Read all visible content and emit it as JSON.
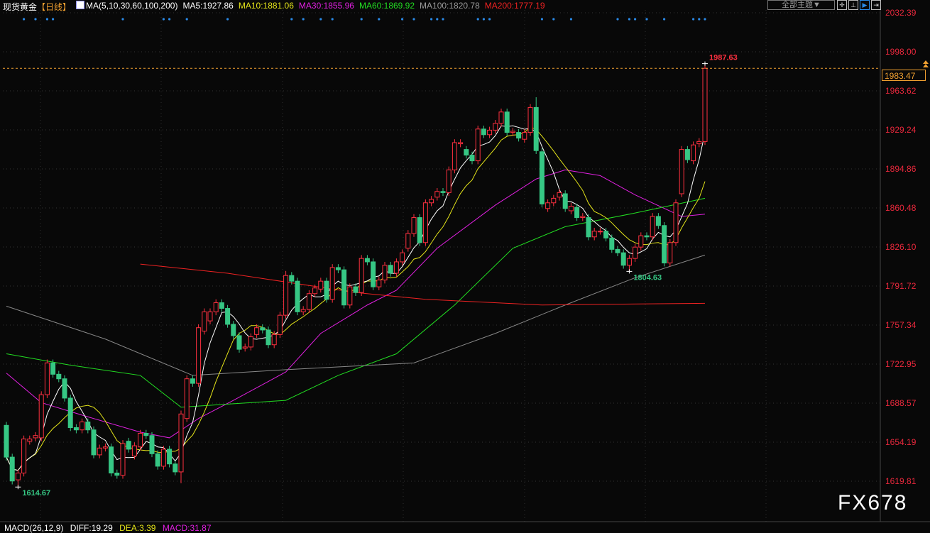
{
  "header": {
    "symbol": "现货黄金",
    "period": "【日线】",
    "ma_params": "MA(5,10,30,60,100,200)",
    "ma5": "MA5:1927.86",
    "ma10": "MA10:1881.06",
    "ma30": "MA30:1855.96",
    "ma60": "MA60:1869.92",
    "ma100": "MA100:1820.78",
    "ma200": "MA200:1777.19"
  },
  "toolbar": {
    "theme_label": "全部主题▼",
    "icons": [
      "crosshair-icon",
      "range-icon",
      "play-icon",
      "shift-right-icon"
    ]
  },
  "watermark": "FX678",
  "macd": {
    "params": "MACD(26,12,9)",
    "diff": "DIFF:19.29",
    "dea": "DEA:3.39",
    "macd": "MACD:31.87"
  },
  "colors": {
    "up": "#ff3040",
    "down": "#36c784",
    "ma5": "#ffffff",
    "ma10": "#e5e51a",
    "ma30": "#e020e0",
    "ma60": "#22dd22",
    "ma100": "#888888",
    "ma200": "#ee2222",
    "accent": "#f0a030"
  },
  "chart_data": {
    "type": "candlestick",
    "title": "现货黄金 日线",
    "ylim": [
      1619.81,
      2032.39
    ],
    "y_ticks": [
      "2032.39",
      "1998.00",
      "1963.62",
      "1929.24",
      "1894.86",
      "1860.48",
      "1826.10",
      "1791.72",
      "1757.34",
      "1722.95",
      "1688.57",
      "1654.19",
      "1619.81"
    ],
    "current_price": "1983.47",
    "high_label": "1987.63",
    "low_labels": [
      "1614.67",
      "1804.63"
    ],
    "open": [
      1669,
      1641,
      1621,
      1627,
      1655,
      1658,
      1658,
      1696,
      1724,
      1714,
      1710,
      1693,
      1667,
      1665,
      1672,
      1665,
      1643,
      1649,
      1650,
      1627,
      1625,
      1655,
      1642,
      1650,
      1662,
      1660,
      1644,
      1633,
      1648,
      1635,
      1628,
      1675,
      1710,
      1706,
      1752,
      1761,
      1769,
      1777,
      1772,
      1758,
      1748,
      1737,
      1738,
      1749,
      1755,
      1753,
      1740,
      1749,
      1766,
      1801,
      1796,
      1769,
      1771,
      1785,
      1789,
      1796,
      1780,
      1808,
      1806,
      1775,
      1791,
      1786,
      1816,
      1813,
      1791,
      1797,
      1810,
      1803,
      1813,
      1825,
      1838,
      1852,
      1830,
      1865,
      1870,
      1875,
      1874,
      1894,
      1917,
      1912,
      1907,
      1902,
      1930,
      1925,
      1929,
      1935,
      1945,
      1927,
      1927,
      1921,
      1927,
      1949,
      1910,
      1860,
      1865,
      1870,
      1873,
      1858,
      1861,
      1852,
      1852,
      1835,
      1840,
      1840,
      1834,
      1824,
      1821,
      1810,
      1816,
      1826,
      1836,
      1835,
      1853,
      1845,
      1812,
      1830,
      1873,
      1912,
      1902,
      1917,
      1919
    ],
    "close": [
      1641,
      1620,
      1627,
      1657,
      1657,
      1660,
      1696,
      1724,
      1714,
      1710,
      1693,
      1667,
      1665,
      1672,
      1665,
      1643,
      1649,
      1650,
      1627,
      1625,
      1653,
      1648,
      1651,
      1662,
      1660,
      1644,
      1633,
      1648,
      1635,
      1628,
      1679,
      1710,
      1706,
      1755,
      1769,
      1769,
      1777,
      1772,
      1758,
      1748,
      1736,
      1738,
      1747,
      1755,
      1753,
      1740,
      1749,
      1766,
      1801,
      1796,
      1769,
      1771,
      1785,
      1790,
      1796,
      1780,
      1808,
      1806,
      1775,
      1791,
      1786,
      1816,
      1813,
      1791,
      1797,
      1810,
      1803,
      1813,
      1821,
      1838,
      1852,
      1830,
      1865,
      1868,
      1875,
      1874,
      1894,
      1918,
      1918,
      1907,
      1902,
      1930,
      1925,
      1929,
      1935,
      1945,
      1927,
      1928,
      1922,
      1927,
      1949,
      1911,
      1864,
      1865,
      1869,
      1874,
      1860,
      1862,
      1852,
      1853,
      1835,
      1840,
      1840,
      1834,
      1824,
      1821,
      1810,
      1816,
      1826,
      1836,
      1835,
      1853,
      1845,
      1812,
      1830,
      1865,
      1912,
      1903,
      1916,
      1919,
      1983.47
    ],
    "high_overrides": [
      [
        120,
        1987.63
      ],
      [
        91,
        1958
      ],
      [
        34,
        1772
      ],
      [
        48,
        1805
      ]
    ],
    "low_overrides": [
      [
        2,
        1614.67
      ],
      [
        107,
        1804.63
      ],
      [
        30,
        1618
      ]
    ],
    "ma_series": [
      {
        "name": "MA30",
        "color_key": "ma30",
        "points": [
          [
            0,
            1715
          ],
          [
            6,
            1689
          ],
          [
            13,
            1678
          ],
          [
            23,
            1663
          ],
          [
            28,
            1658
          ],
          [
            33,
            1675
          ],
          [
            39,
            1691
          ],
          [
            48,
            1716
          ],
          [
            54,
            1750
          ],
          [
            62,
            1775
          ],
          [
            67,
            1788
          ],
          [
            74,
            1825
          ],
          [
            84,
            1863
          ],
          [
            91,
            1886
          ],
          [
            96,
            1894
          ],
          [
            102,
            1889
          ],
          [
            108,
            1872
          ],
          [
            116,
            1853
          ],
          [
            120,
            1855
          ]
        ]
      },
      {
        "name": "MA60",
        "color_key": "ma60",
        "points": [
          [
            0,
            1732
          ],
          [
            11,
            1722
          ],
          [
            23,
            1713
          ],
          [
            30,
            1685
          ],
          [
            39,
            1688
          ],
          [
            48,
            1691
          ],
          [
            57,
            1713
          ],
          [
            67,
            1732
          ],
          [
            77,
            1775
          ],
          [
            87,
            1825
          ],
          [
            96,
            1844
          ],
          [
            108,
            1856
          ],
          [
            120,
            1869
          ]
        ]
      },
      {
        "name": "MA100",
        "color_key": "ma100",
        "points": [
          [
            0,
            1774
          ],
          [
            17,
            1745
          ],
          [
            32,
            1713
          ],
          [
            48,
            1718
          ],
          [
            70,
            1724
          ],
          [
            84,
            1750
          ],
          [
            96,
            1775
          ],
          [
            108,
            1799
          ],
          [
            120,
            1819
          ]
        ]
      },
      {
        "name": "MA200",
        "color_key": "ma200",
        "points": [
          [
            23,
            1811
          ],
          [
            38,
            1803
          ],
          [
            60,
            1786
          ],
          [
            72,
            1780
          ],
          [
            92,
            1775
          ],
          [
            120,
            1776.5
          ]
        ]
      }
    ],
    "event_marker_indices": [
      3,
      5,
      7,
      8,
      20,
      27,
      28,
      31,
      38,
      49,
      51,
      54,
      56,
      61,
      64,
      68,
      70,
      73,
      74,
      75,
      81,
      82,
      83,
      92,
      94,
      97,
      105,
      107,
      108,
      110,
      113,
      118,
      119,
      120
    ],
    "grid": true
  }
}
